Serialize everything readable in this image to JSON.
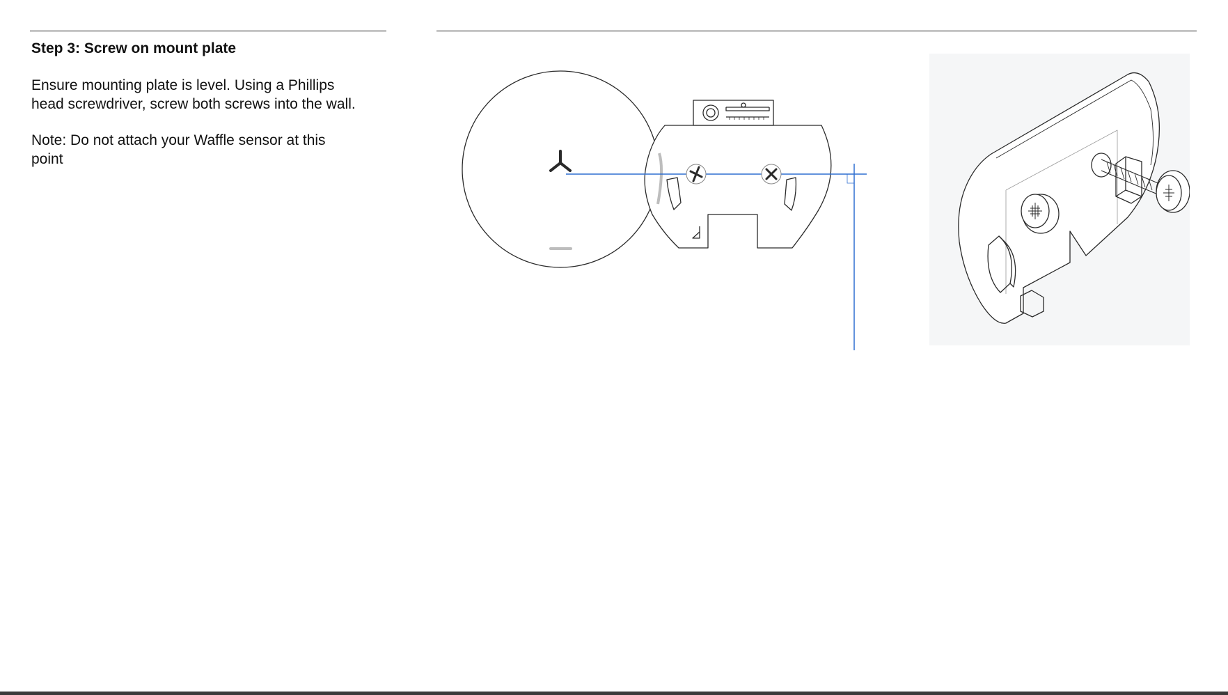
{
  "step": {
    "title": "Step 3: Screw on mount plate",
    "instruction": "Ensure mounting plate is level. Using a Phillips head screwdriver, screw both screws into the wall.",
    "note": "Note: Do not attach your Waffle sensor at this point"
  },
  "diagram": {
    "guide_color": "#2f6fd0",
    "line_color": "#2a2a2a",
    "panel_bg": "#f5f6f7",
    "icons": [
      "sensor-disc",
      "mount-plate",
      "bubble-level",
      "screw-icon",
      "iso-mount-plate"
    ]
  }
}
